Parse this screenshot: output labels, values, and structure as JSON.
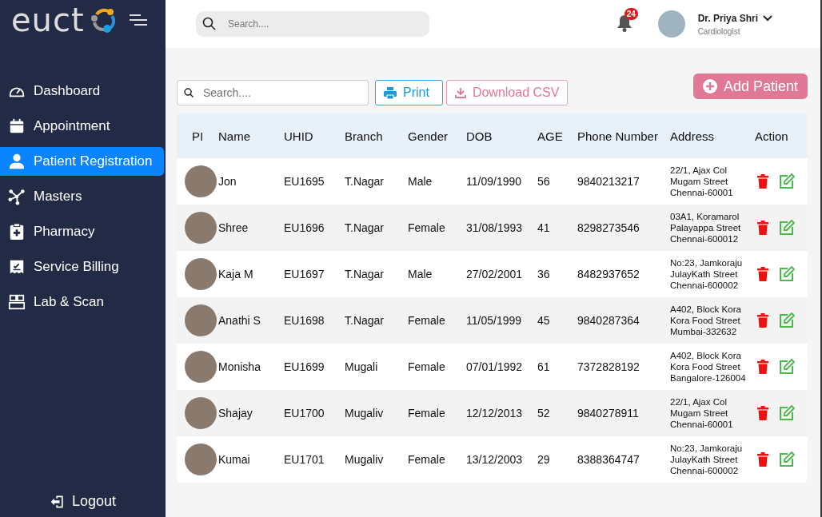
{
  "brand": {
    "logo_text": "euct"
  },
  "topbar": {
    "search": {
      "placeholder": "Search...."
    },
    "notifications": {
      "count": "24"
    },
    "user": {
      "name": "Dr. Priya Shri",
      "role": "Cardiologist"
    }
  },
  "sidebar": {
    "items": [
      {
        "label": "Dashboard",
        "selected": false
      },
      {
        "label": "Appointment",
        "selected": false
      },
      {
        "label": "Patient Registration",
        "selected": true
      },
      {
        "label": "Masters",
        "selected": false
      },
      {
        "label": "Pharmacy",
        "selected": false
      },
      {
        "label": "Service Billing",
        "selected": false
      },
      {
        "label": "Lab & Scan",
        "selected": false
      }
    ],
    "logout": "Logout"
  },
  "toolbar": {
    "search": {
      "placeholder": "Search...."
    },
    "print": "Print",
    "download": "Download CSV",
    "add": "Add Patient"
  },
  "table": {
    "columns": [
      "PI",
      "Name",
      "UHID",
      "Branch",
      "Gender",
      "DOB",
      "AGE",
      "Phone Number",
      "Address",
      "Action"
    ],
    "rows": [
      {
        "name": "Jon",
        "uhid": "EU1695",
        "branch": "T.Nagar",
        "gender": "Male",
        "dob": "11/09/1990",
        "age": "56",
        "phone": "9840213217",
        "address": [
          "22/1, Ajax Col",
          "Mugam Street",
          "Chennai-60001"
        ]
      },
      {
        "name": "Shree",
        "uhid": "EU1696",
        "branch": "T.Nagar",
        "gender": "Female",
        "dob": "31/08/1993",
        "age": "41",
        "phone": "8298273546",
        "address": [
          "03A1, Koramarol",
          "Palayappa Street",
          "Chennai-600012"
        ]
      },
      {
        "name": "Kaja M",
        "uhid": "EU1697",
        "branch": "T.Nagar",
        "gender": "Male",
        "dob": "27/02/2001",
        "age": "36",
        "phone": "8482937652",
        "address": [
          "No:23, Jamkoraju",
          "JulayKath Street",
          "Chennai-600002"
        ]
      },
      {
        "name": "Anathi S",
        "uhid": "EU1698",
        "branch": "T.Nagar",
        "gender": "Female",
        "dob": "11/05/1999",
        "age": "45",
        "phone": "9840287364",
        "address": [
          "A402, Block Kora",
          "Kora Food Street",
          "Mumbai-332632"
        ]
      },
      {
        "name": "Monisha",
        "uhid": "EU1699",
        "branch": "Mugali",
        "gender": "Female",
        "dob": "07/01/1992",
        "age": "61",
        "phone": "7372828192",
        "address": [
          "A402, Block Kora",
          "Kora Food Street",
          "Bangalore-126004"
        ]
      },
      {
        "name": "Shajay",
        "uhid": "EU1700",
        "branch": "Mugaliv",
        "gender": "Female",
        "dob": "12/12/2013",
        "age": "52",
        "phone": "9840278911",
        "address": [
          "22/1, Ajax Col",
          "Mugam Street",
          "Chennai-60001"
        ]
      },
      {
        "name": "Kumai",
        "uhid": "EU1701",
        "branch": "Mugaliv",
        "gender": "Female",
        "dob": "13/12/2003",
        "age": "29",
        "phone": "8388364747",
        "address": [
          "No:23, Jamkoraju",
          "JulayKath Street",
          "Chennai-600002"
        ]
      }
    ]
  }
}
